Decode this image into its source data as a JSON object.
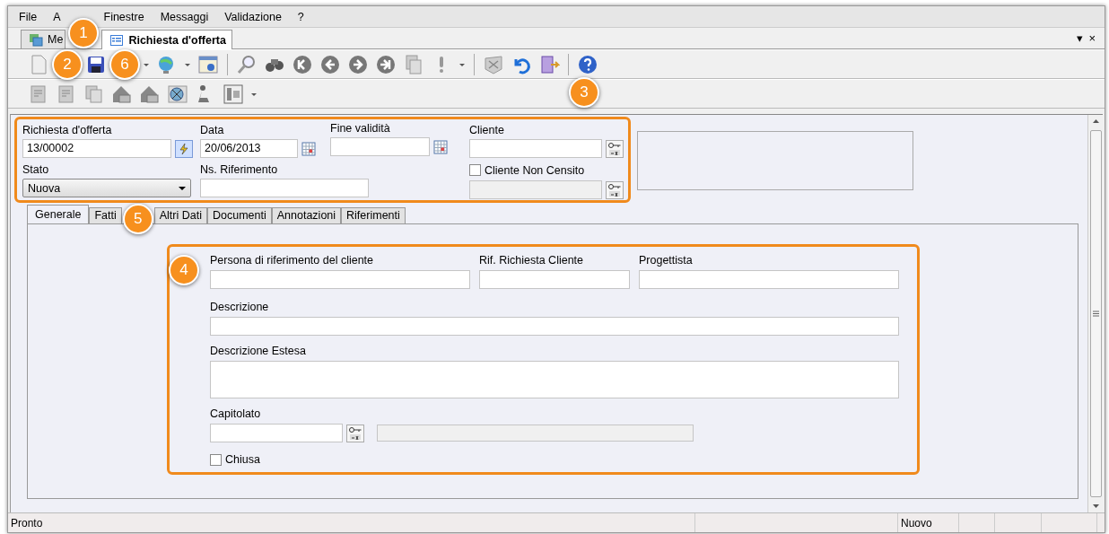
{
  "menu": [
    {
      "label": "File"
    },
    {
      "label": "A"
    },
    {
      "label": "Finestre"
    },
    {
      "label": "Messaggi"
    },
    {
      "label": "Validazione"
    },
    {
      "label": "?"
    }
  ],
  "document_tabs": [
    {
      "label": "Me",
      "selected": false
    },
    {
      "label": "Richiesta d'offerta",
      "selected": true
    }
  ],
  "tab_strip_controls": [
    "▾",
    "×"
  ],
  "header_form": {
    "order_number": {
      "label": "Richiesta d'offerta",
      "value": "13/00002"
    },
    "date": {
      "label": "Data",
      "value": "20/06/2013"
    },
    "validity_end": {
      "label": "Fine validità"
    },
    "customer": {
      "label": "Cliente"
    },
    "status": {
      "label": "Stato",
      "value": "Nuova"
    },
    "our_reference": {
      "label": "Ns. Riferimento"
    },
    "unregistered_customer": {
      "label": "Cliente Non Censito",
      "checked": false
    }
  },
  "tabs": [
    {
      "label": "Generale",
      "selected": true
    },
    {
      "label": "Fatti",
      "selected": false
    },
    {
      "label": "Altri Dati",
      "selected": false
    },
    {
      "label": "Documenti",
      "selected": false
    },
    {
      "label": "Annotazioni",
      "selected": false
    },
    {
      "label": "Riferimenti",
      "selected": false
    }
  ],
  "general": {
    "customer_contact": {
      "label": "Persona di riferimento del cliente"
    },
    "customer_request_ref": {
      "label": "Rif. Richiesta Cliente"
    },
    "designer": {
      "label": "Progettista"
    },
    "description": {
      "label": "Descrizione"
    },
    "extended_description": {
      "label": "Descrizione Estesa"
    },
    "specification": {
      "label": "Capitolato"
    },
    "closed": {
      "label": "Chiusa",
      "checked": false
    }
  },
  "status_bar": {
    "message": "Pronto",
    "mode": "Nuovo"
  },
  "callouts": [
    {
      "label": "1"
    },
    {
      "label": "2"
    },
    {
      "label": "6"
    },
    {
      "label": "3"
    },
    {
      "label": "5"
    },
    {
      "label": "4"
    }
  ]
}
